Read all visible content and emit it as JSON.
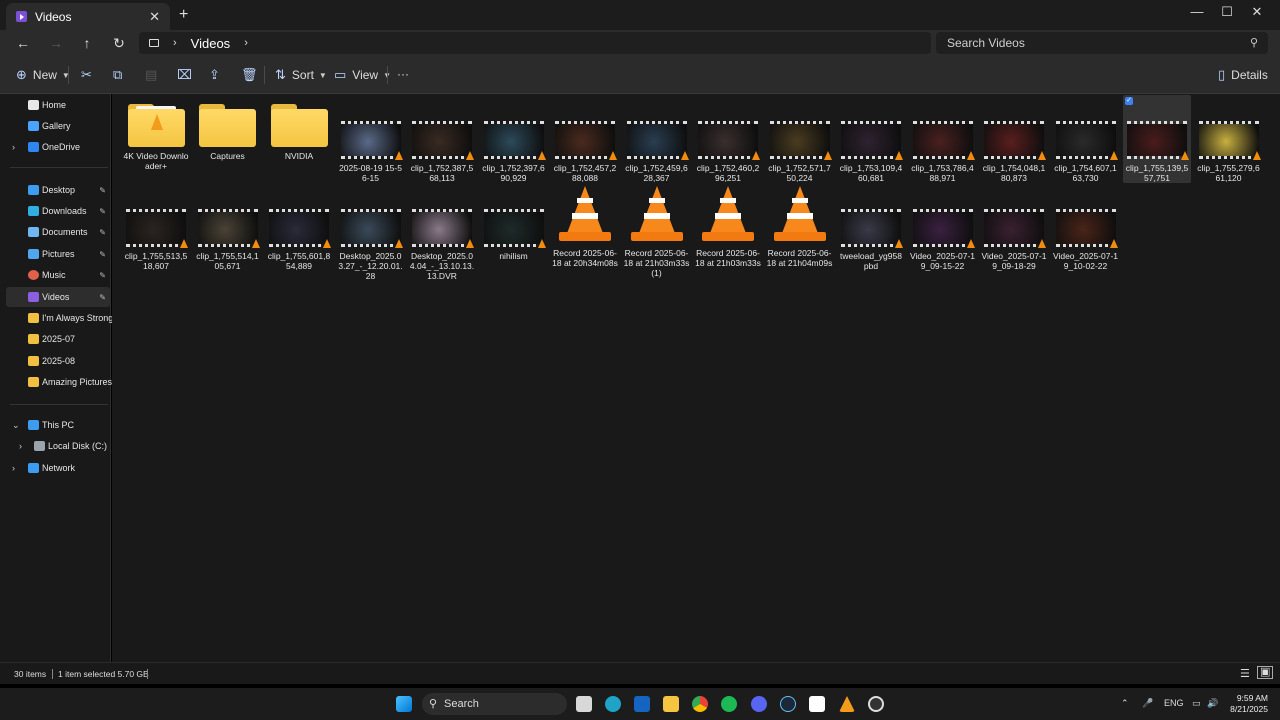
{
  "window": {
    "tab_title": "Videos",
    "tab_close": "✕",
    "new_tab": "+",
    "minimize": "—",
    "maximize": "☐",
    "close": "✕"
  },
  "nav": {
    "back": "←",
    "forward": "→",
    "up": "↑",
    "refresh": "↻",
    "breadcrumb": [
      "Videos"
    ],
    "search_placeholder": "Search Videos"
  },
  "toolbar": {
    "new_label": "New",
    "sort_label": "Sort",
    "view_label": "View",
    "more_label": "···",
    "details_label": "Details"
  },
  "sidebar": {
    "items": [
      {
        "label": "Home",
        "icon": "home-icon",
        "color": "#e8e8e8"
      },
      {
        "label": "Gallery",
        "icon": "gallery-icon",
        "color": "#4aa3ff"
      },
      {
        "label": "OneDrive",
        "icon": "onedrive-icon",
        "color": "#2f86f0"
      },
      {
        "label": "Desktop",
        "icon": "desktop-icon",
        "color": "#3d9bf0"
      },
      {
        "label": "Downloads",
        "icon": "downloads-icon",
        "color": "#2fb0e0"
      },
      {
        "label": "Documents",
        "icon": "documents-icon",
        "color": "#6fb6f2"
      },
      {
        "label": "Pictures",
        "icon": "pictures-icon",
        "color": "#4fa6ee"
      },
      {
        "label": "Music",
        "icon": "music-icon",
        "color": "#e0604a"
      },
      {
        "label": "Videos",
        "icon": "videos-icon",
        "color": "#8a5fe0"
      },
      {
        "label": "I'm Always Strong",
        "icon": "folder-icon",
        "color": "#f1c040"
      },
      {
        "label": "2025-07",
        "icon": "folder-icon",
        "color": "#f1c040"
      },
      {
        "label": "2025-08",
        "icon": "folder-icon",
        "color": "#f1c040"
      },
      {
        "label": "Amazing Pictures",
        "icon": "folder-icon",
        "color": "#f1c040"
      },
      {
        "label": "This PC",
        "icon": "this-pc-icon",
        "color": "#3d9bf0"
      },
      {
        "label": "Local Disk (C:)",
        "icon": "disk-icon",
        "color": "#9aa4ad"
      },
      {
        "label": "Network",
        "icon": "network-icon",
        "color": "#3d9bf0"
      }
    ]
  },
  "files": {
    "row1": [
      {
        "label": "4K Video Downloader+",
        "kind": "folder-vlc"
      },
      {
        "label": "Captures",
        "kind": "folder"
      },
      {
        "label": "NVIDIA",
        "kind": "folder"
      },
      {
        "label": "2025-08-19 15-56-15",
        "kind": "video",
        "tint": "#5a6a88"
      },
      {
        "label": "clip_1,752,387,568,113",
        "kind": "video",
        "tint": "#3a2a22"
      },
      {
        "label": "clip_1,752,397,690,929",
        "kind": "video",
        "tint": "#2c4a5a"
      },
      {
        "label": "clip_1,752,457,288,088",
        "kind": "video",
        "tint": "#4a2a1e"
      },
      {
        "label": "clip_1,752,459,628,367",
        "kind": "video",
        "tint": "#2a3e52"
      },
      {
        "label": "clip_1,752,460,296,251",
        "kind": "video",
        "tint": "#3a2e2e"
      },
      {
        "label": "clip_1,752,571,750,224",
        "kind": "video",
        "tint": "#4a3c20"
      },
      {
        "label": "clip_1,753,109,460,681",
        "kind": "video",
        "tint": "#2e2230"
      },
      {
        "label": "clip_1,753,786,488,971",
        "kind": "video",
        "tint": "#4a2020"
      },
      {
        "label": "clip_1,754,048,180,873",
        "kind": "video",
        "tint": "#5a1e1e"
      },
      {
        "label": "clip_1,754,607,163,730",
        "kind": "video",
        "tint": "#2a2a2a"
      },
      {
        "label": "clip_1,755,139,557,751",
        "kind": "video",
        "tint": "#4a1c1c",
        "selected": true
      },
      {
        "label": "clip_1,755,279,661,120",
        "kind": "video",
        "tint": "#c8b040"
      }
    ],
    "row2": [
      {
        "label": "clip_1,755,513,518,607",
        "kind": "video",
        "tint": "#2a2420"
      },
      {
        "label": "clip_1,755,514,105,671",
        "kind": "video",
        "tint": "#4a4236"
      },
      {
        "label": "clip_1,755,601,854,889",
        "kind": "video",
        "tint": "#2a2a3a"
      },
      {
        "label": "Desktop_2025.03.27_-_12.20.01.28",
        "kind": "video",
        "tint": "#3a4a5a"
      },
      {
        "label": "Desktop_2025.04.04_-_13.10.13.13.DVR",
        "kind": "video",
        "tint": "#8a7a8a"
      },
      {
        "label": "nihilism",
        "kind": "video",
        "tint": "#1e2a2a"
      },
      {
        "label": "Record 2025-06-18 at 20h34m08s",
        "kind": "vlc"
      },
      {
        "label": "Record 2025-06-18 at 21h03m33s (1)",
        "kind": "vlc"
      },
      {
        "label": "Record 2025-06-18 at 21h03m33s",
        "kind": "vlc"
      },
      {
        "label": "Record 2025-06-18 at 21h04m09s",
        "kind": "vlc"
      },
      {
        "label": "tweeload_yg958pbd",
        "kind": "video",
        "tint": "#3a3a48"
      },
      {
        "label": "Video_2025-07-19_09-15-22",
        "kind": "video",
        "tint": "#3a2040"
      },
      {
        "label": "Video_2025-07-19_09-18-29",
        "kind": "video",
        "tint": "#3a2030"
      },
      {
        "label": "Video_2025-07-19_10-02-22",
        "kind": "video",
        "tint": "#4a2418"
      }
    ]
  },
  "status": {
    "count": "30 items",
    "selection": "1 item selected  5.70 GB"
  },
  "taskbar": {
    "search_label": "Search",
    "lang": "ENG",
    "time": "9:59 AM",
    "date": "8/21/2025"
  }
}
